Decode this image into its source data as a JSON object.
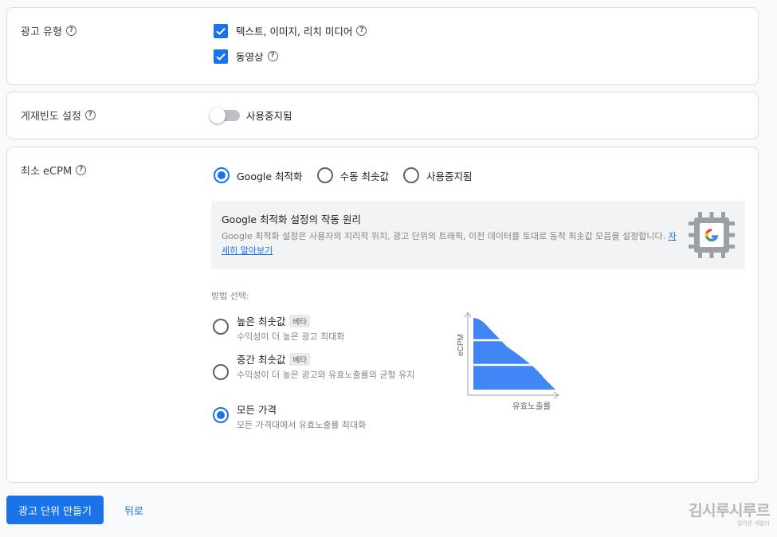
{
  "ad_type": {
    "label": "광고 유형",
    "options": [
      {
        "label": "텍스트, 이미지, 리치 미디어",
        "checked": true
      },
      {
        "label": "동영상",
        "checked": true
      }
    ]
  },
  "frequency": {
    "label": "게재빈도 설정",
    "toggle_label": "사용중지됨",
    "enabled": false
  },
  "ecpm": {
    "label": "최소 eCPM",
    "modes": [
      {
        "label": "Google 최적화",
        "selected": true
      },
      {
        "label": "수동 최솟값",
        "selected": false
      },
      {
        "label": "사용중지됨",
        "selected": false
      }
    ],
    "info": {
      "title": "Google 최적화 설정의 작동 원리",
      "desc": "Google 최적화 설정은 사용자의 지리적 위치, 광고 단위의 트래픽, 이전 데이터를 토대로 동적 최솟값 모음을 설정합니다.",
      "link": "자세히 알아보기"
    },
    "method_label": "방법 선택:",
    "methods": [
      {
        "title": "높은 최솟값",
        "badge": "베타",
        "desc": "수익성이 더 높은 광고 최대화",
        "selected": false
      },
      {
        "title": "중간 최솟값",
        "badge": "베타",
        "desc": "수익성이 더 높은 광고와 유효노출률의 균형 유지",
        "selected": false
      },
      {
        "title": "모든 가격",
        "badge": "",
        "desc": "모든 가격대에서 유효노출률 최대화",
        "selected": true
      }
    ],
    "chart": {
      "y_label": "eCPM",
      "x_label": "유효노출률"
    }
  },
  "footer": {
    "create_button": "광고 단위 만들기",
    "back_button": "뒤로"
  },
  "watermark": {
    "main": "김시루시루르",
    "sub": "알려준 개발자"
  },
  "colors": {
    "primary": "#1a73e8",
    "chart_fill": "#4285f4"
  }
}
